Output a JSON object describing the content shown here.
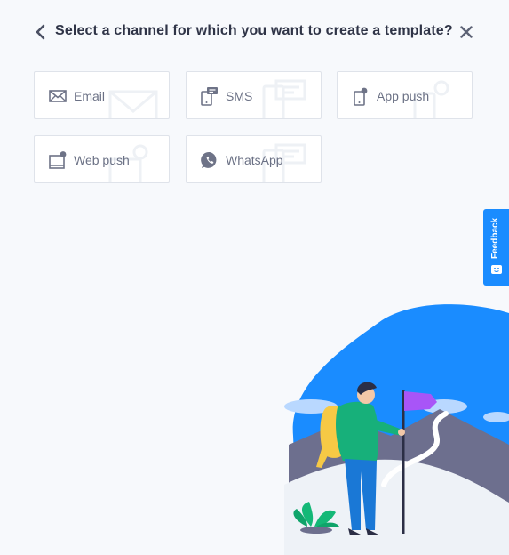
{
  "header": {
    "title": "Select a channel for which you want to create a template?",
    "back_icon": "chevron-left-icon",
    "close_icon": "close-icon"
  },
  "channels": [
    {
      "label": "Email",
      "icon": "email-icon"
    },
    {
      "label": "SMS",
      "icon": "sms-icon"
    },
    {
      "label": "App push",
      "icon": "app-push-icon"
    },
    {
      "label": "Web push",
      "icon": "web-push-icon"
    },
    {
      "label": "WhatsApp",
      "icon": "whatsapp-icon"
    }
  ],
  "feedback": {
    "label": "Feedback",
    "icon": "feedback-icon"
  },
  "colors": {
    "accent": "#1a8cff",
    "card_border": "#dfe3ea",
    "background": "#f7f9fc",
    "icon": "#6e7387",
    "flag": "#a855f7"
  }
}
